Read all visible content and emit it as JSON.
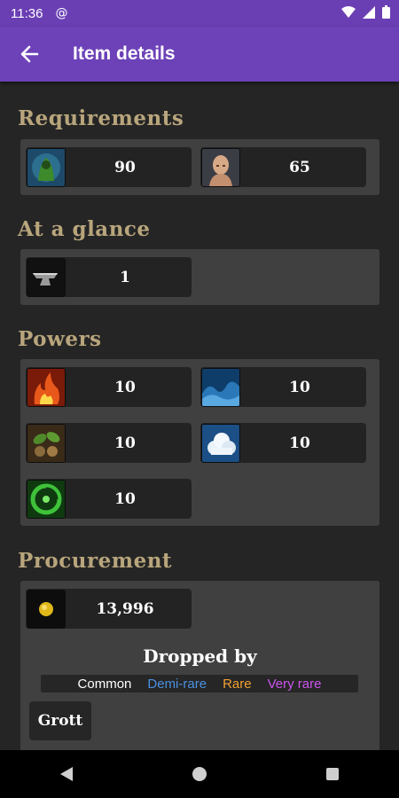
{
  "status_bar": {
    "time": "11:36"
  },
  "app_bar": {
    "title": "Item details"
  },
  "requirements": {
    "title": "Requirements",
    "items": [
      {
        "icon": "green-hooded-figure-icon",
        "value": "90"
      },
      {
        "icon": "bald-head-icon",
        "value": "65"
      }
    ]
  },
  "glance": {
    "title": "At a glance",
    "items": [
      {
        "icon": "anvil-icon",
        "value": "1"
      }
    ]
  },
  "powers": {
    "title": "Powers",
    "items": [
      {
        "icon": "fire-icon",
        "value": "10"
      },
      {
        "icon": "water-wave-icon",
        "value": "10"
      },
      {
        "icon": "earth-leaves-icon",
        "value": "10"
      },
      {
        "icon": "cloud-air-icon",
        "value": "10"
      },
      {
        "icon": "green-swirl-icon",
        "value": "10"
      }
    ]
  },
  "procurement": {
    "title": "Procurement",
    "price": {
      "icon": "gold-coin-icon",
      "value": "13,996"
    },
    "dropped_by": "Dropped by",
    "legend": [
      {
        "label": "Common",
        "color": "#ffffff"
      },
      {
        "label": "Demi-rare",
        "color": "#4a90e2"
      },
      {
        "label": "Rare",
        "color": "#f0a030"
      },
      {
        "label": "Very rare",
        "color": "#cc55ee"
      }
    ],
    "monsters": [
      {
        "name": "Grott"
      }
    ]
  }
}
